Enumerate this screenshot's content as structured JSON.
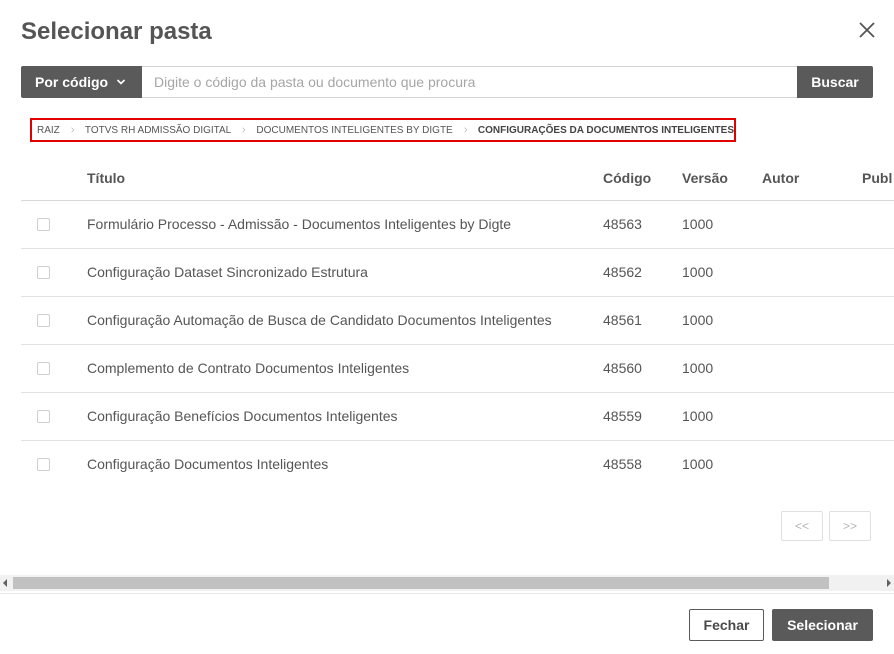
{
  "dialog": {
    "title": "Selecionar pasta"
  },
  "search": {
    "mode_label": "Por código",
    "placeholder": "Digite o código da pasta ou documento que procura",
    "value": "",
    "button_label": "Buscar"
  },
  "breadcrumb": {
    "items": [
      "RAIZ",
      "TOTVS RH ADMISSÃO DIGITAL",
      "DOCUMENTOS INTELIGENTES BY DIGTE",
      "CONFIGURAÇÕES DA DOCUMENTOS INTELIGENTES"
    ]
  },
  "table": {
    "columns": [
      "Título",
      "Código",
      "Versão",
      "Autor",
      "Publ"
    ],
    "rows": [
      {
        "title": "Formulário Processo - Admissão - Documentos Inteligentes by Digte",
        "code": "48563",
        "version": "1000"
      },
      {
        "title": "Configuração Dataset Sincronizado Estrutura",
        "code": "48562",
        "version": "1000"
      },
      {
        "title": "Configuração Automação de Busca de Candidato Documentos Inteligentes",
        "code": "48561",
        "version": "1000"
      },
      {
        "title": "Complemento de Contrato Documentos Inteligentes",
        "code": "48560",
        "version": "1000"
      },
      {
        "title": "Configuração Benefícios Documentos Inteligentes",
        "code": "48559",
        "version": "1000"
      },
      {
        "title": "Configuração Documentos Inteligentes",
        "code": "48558",
        "version": "1000"
      }
    ]
  },
  "pagination": {
    "prev_label": "<<",
    "next_label": ">>"
  },
  "footer": {
    "close_label": "Fechar",
    "select_label": "Selecionar"
  },
  "icons": {
    "close": "close-icon",
    "chevron_down": "chevron-down-icon",
    "breadcrumb_separator": "chevron-right-icon"
  },
  "colors": {
    "primary_button": "#5a5a5a",
    "highlight_border": "#e00000"
  }
}
